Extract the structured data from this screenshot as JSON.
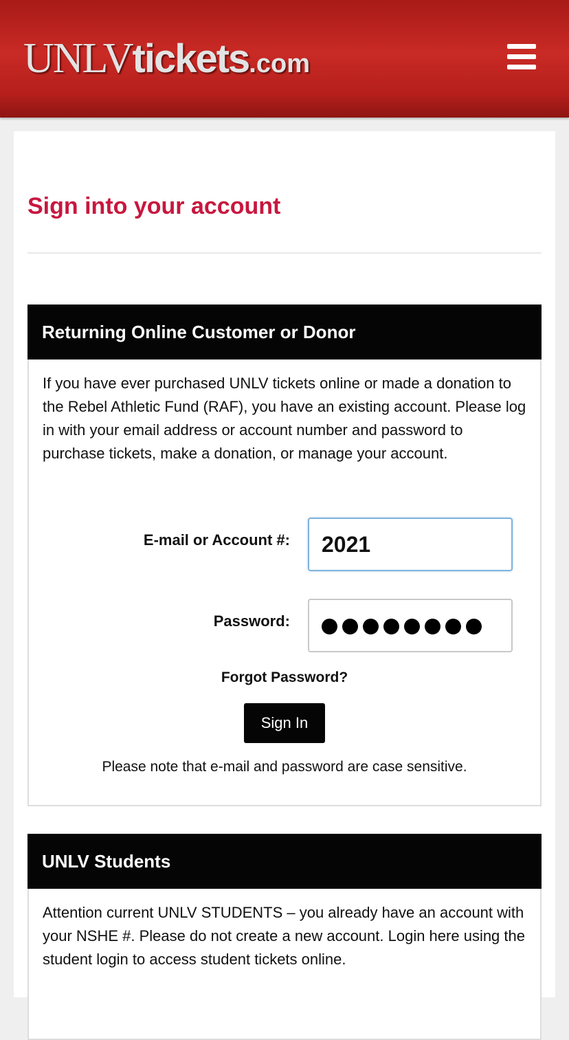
{
  "header": {
    "logo_part1": "UNLV",
    "logo_part2": "tickets",
    "logo_part3": ".com",
    "menu_icon": "hamburger-menu-icon"
  },
  "page": {
    "title": "Sign into your account"
  },
  "returning": {
    "heading": "Returning Online Customer or Donor",
    "description": "If you have ever purchased UNLV tickets online or made a donation to the Rebel Athletic Fund (RAF), you have an existing account. Please log in with your email address or account number and password to purchase tickets, make a donation, or manage your account.",
    "email_label": "E-mail or Account #:",
    "email_value": "2021",
    "password_label": "Password:",
    "password_masked_length": 8,
    "forgot_label": "Forgot Password?",
    "signin_label": "Sign In",
    "note": "Please note that e-mail and password are case sensitive."
  },
  "students": {
    "heading": "UNLV Students",
    "description": "Attention current UNLV STUDENTS – you already have an account with your NSHE #. Please do not create a new account. Login here using the student login to access student tickets online."
  },
  "colors": {
    "brand_red": "#c92a25",
    "title_crimson": "#c8173f",
    "panel_header": "#050505"
  }
}
